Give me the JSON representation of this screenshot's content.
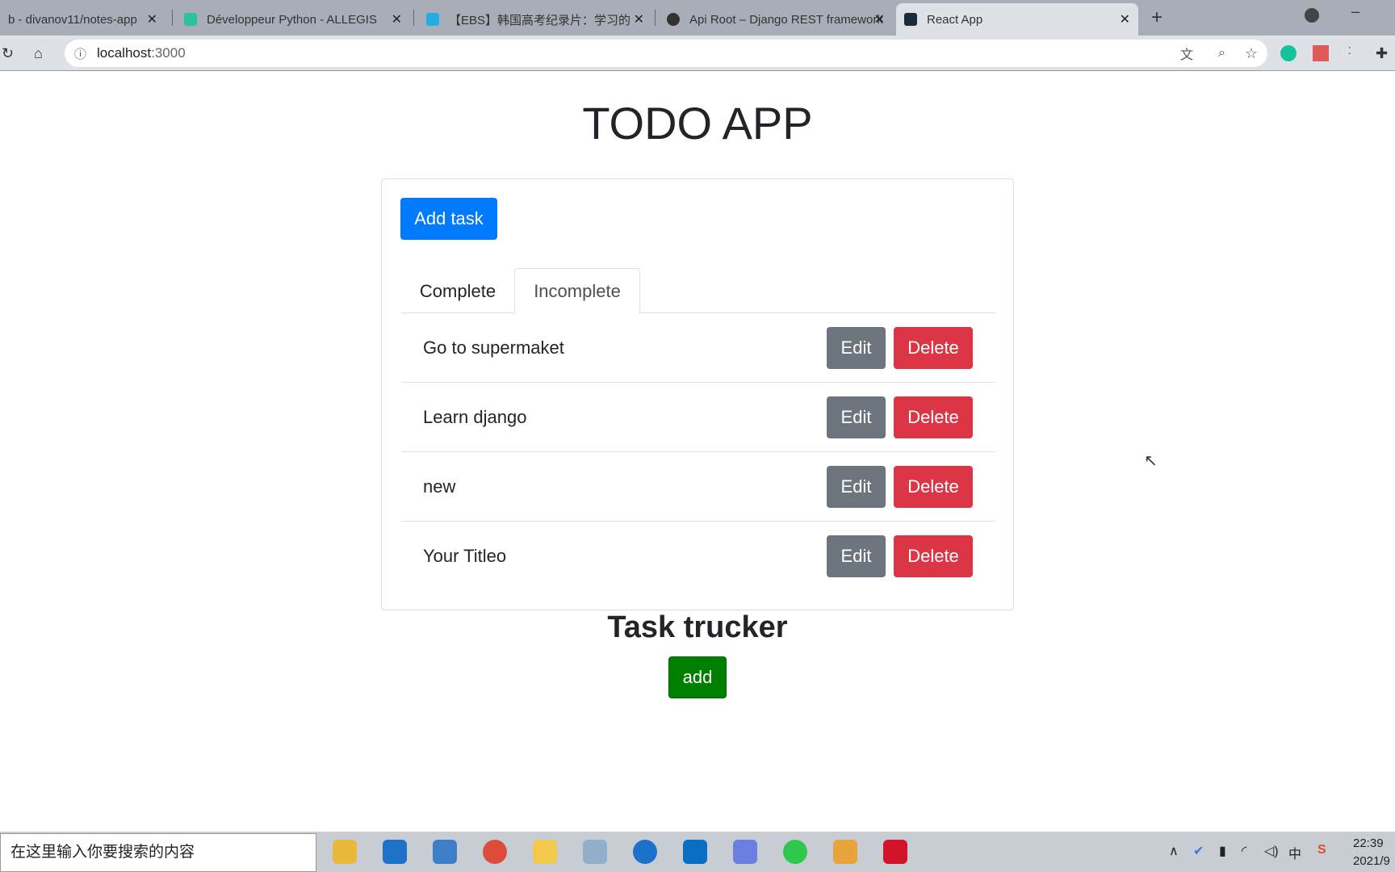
{
  "browser": {
    "tabs": [
      {
        "title": "b - divanov11/notes-app",
        "icon": "github-icon",
        "color": "#333"
      },
      {
        "title": "Développeur Python - ALLEGIS",
        "icon": "allegis-icon",
        "color": "#2cc39a"
      },
      {
        "title": "【EBS】韩国高考纪录片：学习的",
        "icon": "bilibili-icon",
        "color": "#23ade5"
      },
      {
        "title": "Api Root – Django REST framework",
        "icon": "globe-icon",
        "color": "#333"
      },
      {
        "title": "React App",
        "icon": "react-icon",
        "color": "#1b2a3a"
      }
    ],
    "url_host": "localhost",
    "url_port": ":3000"
  },
  "page": {
    "title": "TODO APP",
    "add_task_label": "Add task",
    "tabs": [
      {
        "label": "Complete",
        "active": false
      },
      {
        "label": "Incomplete",
        "active": true
      }
    ],
    "items": [
      {
        "title": "Go to supermaket",
        "edit": "Edit",
        "delete": "Delete"
      },
      {
        "title": "Learn django",
        "edit": "Edit",
        "delete": "Delete"
      },
      {
        "title": "new",
        "edit": "Edit",
        "delete": "Delete"
      },
      {
        "title": "Your Titleo",
        "edit": "Edit",
        "delete": "Delete"
      }
    ],
    "subtitle": "Task trucker",
    "add_label": "add"
  },
  "colors": {
    "primary": "#007bff",
    "secondary": "#6c757d",
    "danger": "#dc3545",
    "success": "#008000"
  },
  "taskbar": {
    "search_placeholder": "在这里输入你要搜索的内容",
    "time": "22:39",
    "date": "2021/9"
  }
}
